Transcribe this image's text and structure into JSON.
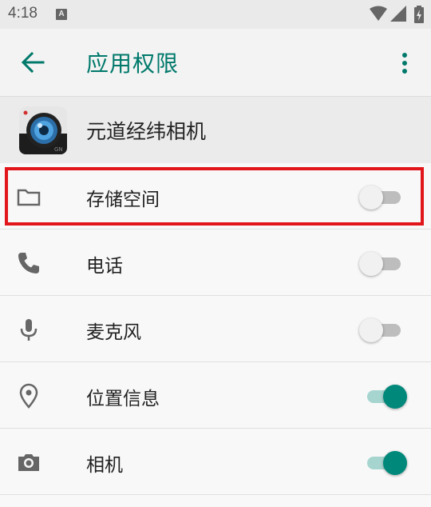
{
  "status_bar": {
    "time": "4:18",
    "notification_icon": "a-letter-icon",
    "icons": [
      "wifi-icon",
      "signal-icon",
      "battery-charging-icon"
    ]
  },
  "app_bar": {
    "title": "应用权限",
    "back_icon": "arrow-back-icon",
    "menu_icon": "more-vert-icon",
    "accent_color": "#00796b"
  },
  "app": {
    "name": "元道经纬相机",
    "icon": "camera-app-icon"
  },
  "permissions": [
    {
      "label": "存储空间",
      "icon": "folder-icon",
      "enabled": false,
      "highlighted": true
    },
    {
      "label": "电话",
      "icon": "phone-icon",
      "enabled": false
    },
    {
      "label": "麦克风",
      "icon": "microphone-icon",
      "enabled": false
    },
    {
      "label": "位置信息",
      "icon": "location-pin-icon",
      "enabled": true
    },
    {
      "label": "相机",
      "icon": "camera-icon",
      "enabled": true
    }
  ],
  "colors": {
    "toggle_on": "#00897b",
    "highlight_border": "#e2151a"
  }
}
